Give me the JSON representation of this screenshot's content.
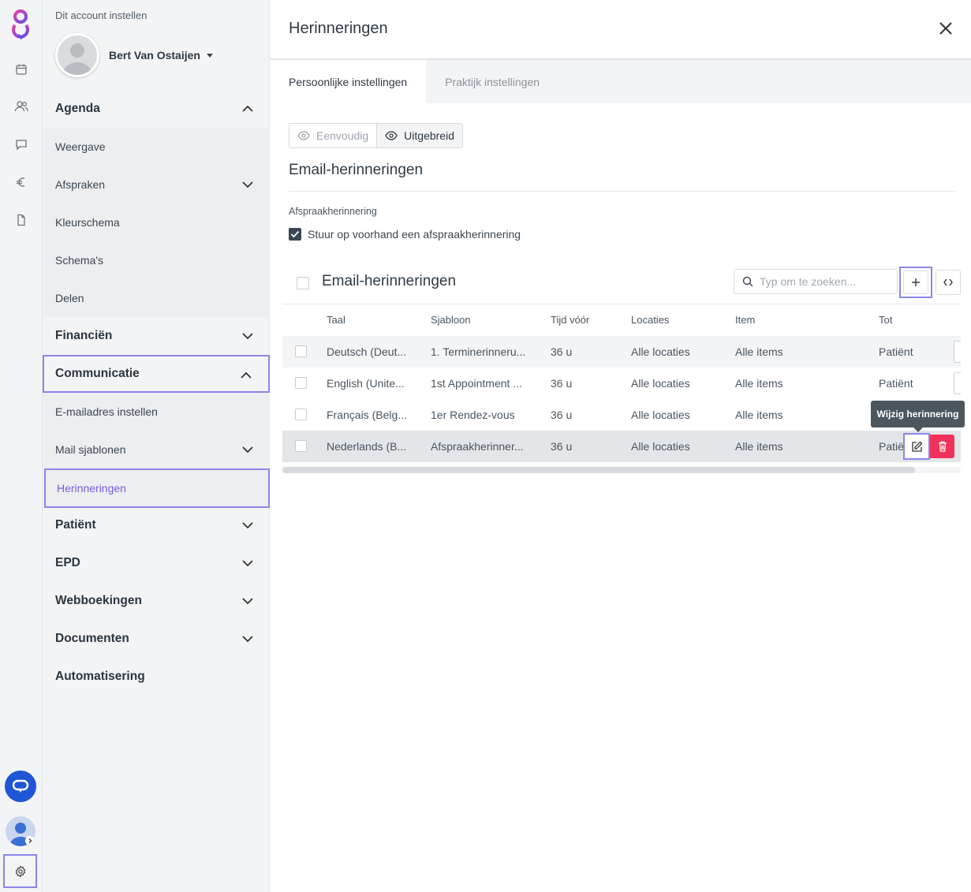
{
  "icons": {
    "logo": "app-logo-icon",
    "rail": [
      "calendar-icon",
      "users-icon",
      "chat-icon",
      "euro-icon",
      "document-icon"
    ],
    "help": "chat-bubble-icon",
    "settings": "gear-icon"
  },
  "colors": {
    "accent": "#8b86ea",
    "active_nav": "#7b5be0",
    "help_blue": "#1f56d6",
    "delete_red": "#f0325a",
    "tooltip_bg": "#4b565e"
  },
  "nav": {
    "account_title": "Dit account instellen",
    "user_name": "Bert Van Ostaijen",
    "items": [
      {
        "label": "Agenda",
        "type": "section",
        "chevron": "up"
      },
      {
        "label": "Weergave",
        "type": "sub"
      },
      {
        "label": "Afspraken",
        "type": "sub",
        "chevron": "down"
      },
      {
        "label": "Kleurschema",
        "type": "sub"
      },
      {
        "label": "Schema's",
        "type": "sub"
      },
      {
        "label": "Delen",
        "type": "sub"
      },
      {
        "label": "Financiën",
        "type": "section",
        "chevron": "down"
      },
      {
        "label": "Communicatie",
        "type": "section",
        "chevron": "up",
        "highlighted": true
      },
      {
        "label": "E-mailadres instellen",
        "type": "sub"
      },
      {
        "label": "Mail sjablonen",
        "type": "sub",
        "chevron": "down"
      },
      {
        "label": "Herinneringen",
        "type": "sub",
        "active": true,
        "highlighted": true
      },
      {
        "label": "Patiënt",
        "type": "section",
        "chevron": "down"
      },
      {
        "label": "EPD",
        "type": "section",
        "chevron": "down"
      },
      {
        "label": "Webboekingen",
        "type": "section",
        "chevron": "down"
      },
      {
        "label": "Documenten",
        "type": "section",
        "chevron": "down"
      },
      {
        "label": "Automatisering",
        "type": "section"
      }
    ]
  },
  "main": {
    "title": "Herinneringen",
    "tabs": [
      {
        "label": "Persoonlijke instellingen",
        "active": true
      },
      {
        "label": "Praktijk instellingen",
        "active": false
      }
    ],
    "view_toggle": {
      "simple": "Eenvoudig",
      "extended": "Uitgebreid",
      "selected": "extended"
    },
    "section_title": "Email-herinneringen",
    "sub_label": "Afspraakherinnering",
    "checkbox_label": "Stuur op voorhand een afspraakherinnering",
    "checkbox_checked": true,
    "table": {
      "title": "Email-herinneringen",
      "search_placeholder": "Typ om te zoeken...",
      "columns": [
        "Taal",
        "Sjabloon",
        "Tijd vóór",
        "Locaties",
        "Item",
        "Tot"
      ],
      "rows": [
        {
          "taal": "Deutsch (Deut...",
          "sjabloon": "1. Terminerinneru...",
          "tijd": "36 u",
          "locaties": "Alle locaties",
          "item": "Alle items",
          "tot": "Patiënt"
        },
        {
          "taal": "English (Unite...",
          "sjabloon": "1st Appointment ...",
          "tijd": "36 u",
          "locaties": "Alle locaties",
          "item": "Alle items",
          "tot": "Patiënt"
        },
        {
          "taal": "Français (Belg...",
          "sjabloon": "1er Rendez-vous",
          "tijd": "36 u",
          "locaties": "Alle locaties",
          "item": "Alle items",
          "tot": ""
        },
        {
          "taal": "Nederlands (B...",
          "sjabloon": "Afspraakherinner...",
          "tijd": "36 u",
          "locaties": "Alle locaties",
          "item": "Alle items",
          "tot": "Patië"
        }
      ],
      "tooltip": "Wijzig herinnering"
    }
  }
}
